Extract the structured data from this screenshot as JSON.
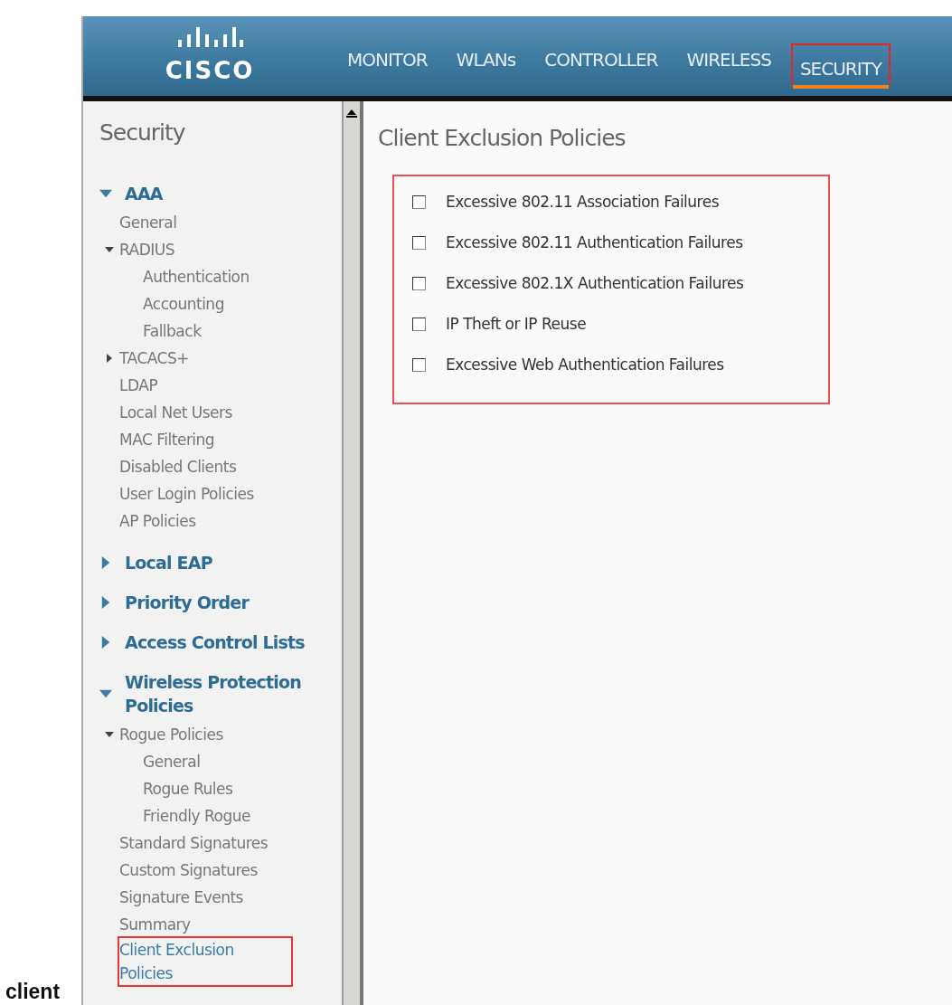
{
  "document_text": {
    "bottom_word": "client"
  },
  "header": {
    "logo": "CISCO",
    "tabs": [
      {
        "label": "MONITOR",
        "selected": false
      },
      {
        "label": "WLANs",
        "selected": false
      },
      {
        "label": "CONTROLLER",
        "selected": false
      },
      {
        "label": "WIRELESS",
        "selected": false
      },
      {
        "label": "SECURITY",
        "selected": true
      }
    ]
  },
  "sidebar": {
    "title": "Security",
    "items": [
      {
        "label": "AAA",
        "kind": "section",
        "expanded": true,
        "selected": false,
        "children": [
          {
            "label": "General",
            "selected": false
          },
          {
            "label": "RADIUS",
            "expanded": true,
            "selected": false,
            "children": [
              {
                "label": "Authentication",
                "selected": false
              },
              {
                "label": "Accounting",
                "selected": false
              },
              {
                "label": "Fallback",
                "selected": false
              }
            ]
          },
          {
            "label": "TACACS+",
            "expanded": false,
            "selected": false
          },
          {
            "label": "LDAP",
            "selected": false
          },
          {
            "label": "Local Net Users",
            "selected": false
          },
          {
            "label": "MAC Filtering",
            "selected": false
          },
          {
            "label": "Disabled Clients",
            "selected": false
          },
          {
            "label": "User Login Policies",
            "selected": false
          },
          {
            "label": "AP Policies",
            "selected": false
          }
        ]
      },
      {
        "label": "Local EAP",
        "kind": "section",
        "expanded": false,
        "selected": false
      },
      {
        "label": "Priority Order",
        "kind": "section",
        "expanded": false,
        "selected": false
      },
      {
        "label": "Access Control Lists",
        "kind": "section",
        "expanded": false,
        "selected": false
      },
      {
        "label": "Wireless Protection Policies",
        "kind": "section",
        "expanded": true,
        "selected": false,
        "children": [
          {
            "label": "Rogue Policies",
            "expanded": true,
            "selected": false,
            "children": [
              {
                "label": "General",
                "selected": false
              },
              {
                "label": "Rogue Rules",
                "selected": false
              },
              {
                "label": "Friendly Rogue",
                "selected": false
              }
            ]
          },
          {
            "label": "Standard Signatures",
            "selected": false
          },
          {
            "label": "Custom Signatures",
            "selected": false
          },
          {
            "label": "Signature Events Summary",
            "selected": false
          },
          {
            "label": "Client Exclusion Policies",
            "selected": true
          }
        ]
      }
    ]
  },
  "content": {
    "title": "Client Exclusion Policies",
    "highlighted": true,
    "options": [
      {
        "label": "Excessive 802.11 Association Failures",
        "checked": false
      },
      {
        "label": "Excessive 802.11 Authentication Failures",
        "checked": false
      },
      {
        "label": "Excessive 802.1X Authentication Failures",
        "checked": false
      },
      {
        "label": "IP Theft or IP Reuse",
        "checked": false
      },
      {
        "label": "Excessive Web Authentication Failures",
        "checked": false
      }
    ]
  }
}
